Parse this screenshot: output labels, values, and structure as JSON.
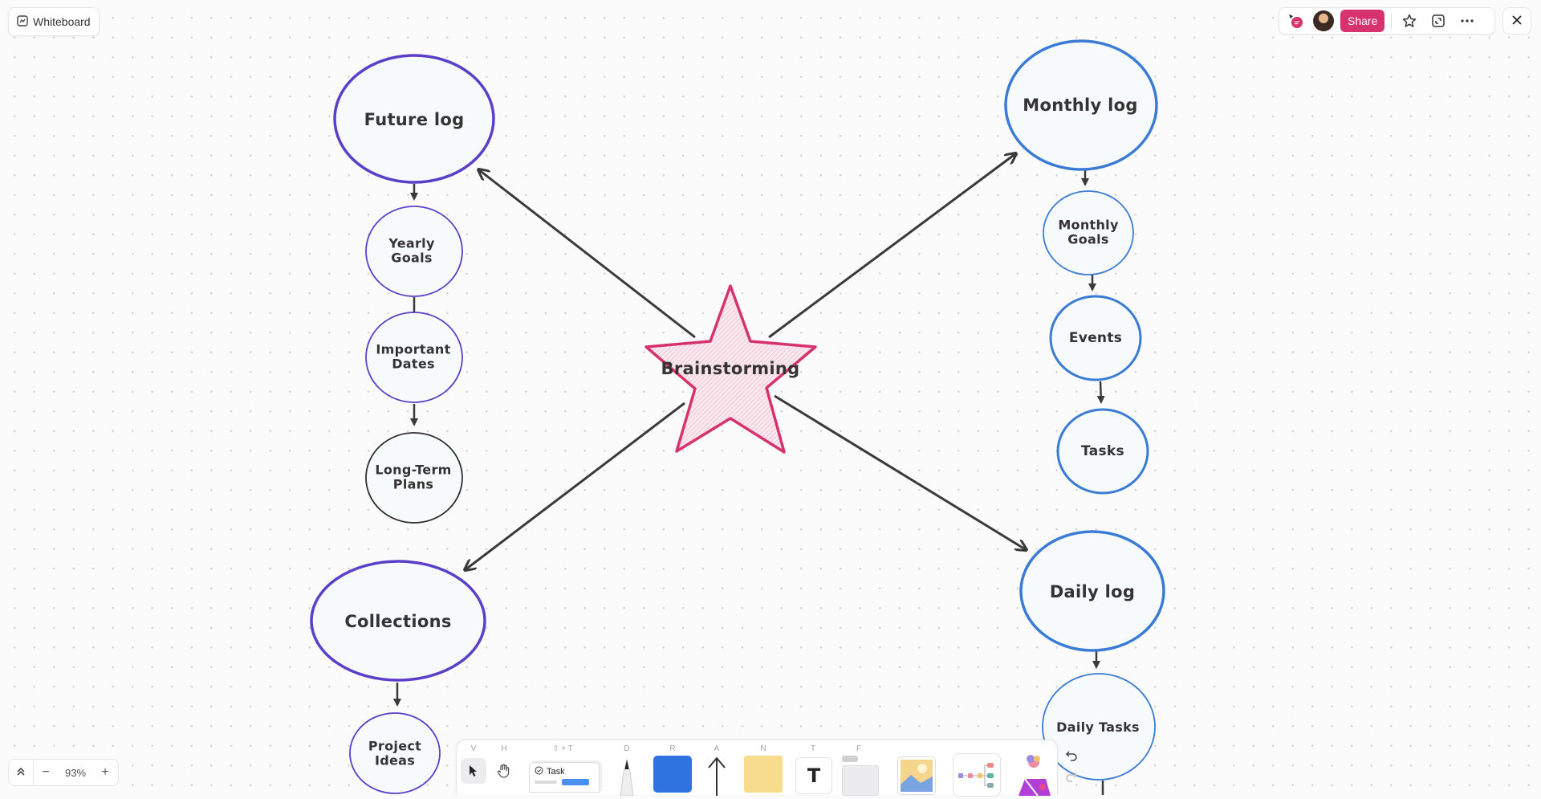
{
  "app": {
    "title": "Whiteboard"
  },
  "header": {
    "share_label": "Share",
    "icons": [
      "comments-icon",
      "avatar",
      "star-icon",
      "fullscreen-icon",
      "more-icon",
      "close-icon"
    ]
  },
  "colors": {
    "purple": "#5b3fc8",
    "blue": "#3a7bd5",
    "pink": "#d6336c",
    "dark": "#3a3a3a"
  },
  "mindmap": {
    "center": {
      "label": "Brainstorming"
    },
    "future_log": {
      "label": "Future log",
      "children": [
        "Yearly\nGoals",
        "Important\nDates",
        "Long-Term\nPlans"
      ]
    },
    "monthly_log": {
      "label": "Monthly log",
      "children": [
        "Monthly\nGoals",
        "Events",
        "Tasks"
      ]
    },
    "collections": {
      "label": "Collections",
      "children": [
        "Project\nIdeas"
      ]
    },
    "daily_log": {
      "label": "Daily log",
      "children": [
        "Daily Tasks"
      ]
    }
  },
  "zoom": {
    "value": "93%",
    "minus": "−",
    "plus": "+"
  },
  "toolbar": {
    "select_key": "V",
    "hand_key": "H",
    "task_key": "⇧ + T",
    "task_label": "Task",
    "pen_key": "D",
    "rect_key": "R",
    "arrow_key": "A",
    "note_key": "N",
    "text_key": "T",
    "text_glyph": "T",
    "frame_key": "F"
  }
}
